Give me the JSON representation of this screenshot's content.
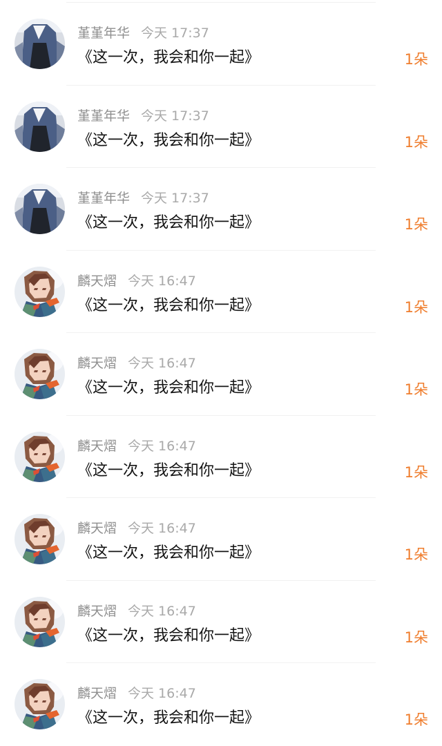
{
  "comments": [
    {
      "avatar": "user-avatar-denim",
      "name": "堇堇年华",
      "time": "今天 17:37",
      "message": "《这一次，我会和你一起》",
      "gift": "1朵"
    },
    {
      "avatar": "user-avatar-denim",
      "name": "堇堇年华",
      "time": "今天 17:37",
      "message": "《这一次，我会和你一起》",
      "gift": "1朵"
    },
    {
      "avatar": "user-avatar-denim",
      "name": "堇堇年华",
      "time": "今天 17:37",
      "message": "《这一次，我会和你一起》",
      "gift": "1朵"
    },
    {
      "avatar": "user-avatar-anime",
      "name": "麟天熠",
      "time": "今天 16:47",
      "message": "《这一次，我会和你一起》",
      "gift": "1朵"
    },
    {
      "avatar": "user-avatar-anime",
      "name": "麟天熠",
      "time": "今天 16:47",
      "message": "《这一次，我会和你一起》",
      "gift": "1朵"
    },
    {
      "avatar": "user-avatar-anime",
      "name": "麟天熠",
      "time": "今天 16:47",
      "message": "《这一次，我会和你一起》",
      "gift": "1朵"
    },
    {
      "avatar": "user-avatar-anime",
      "name": "麟天熠",
      "time": "今天 16:47",
      "message": "《这一次，我会和你一起》",
      "gift": "1朵"
    },
    {
      "avatar": "user-avatar-anime",
      "name": "麟天熠",
      "time": "今天 16:47",
      "message": "《这一次，我会和你一起》",
      "gift": "1朵"
    },
    {
      "avatar": "user-avatar-anime",
      "name": "麟天熠",
      "time": "今天 16:47",
      "message": "《这一次，我会和你一起》",
      "gift": "1朵"
    }
  ],
  "colors": {
    "gift": "#ef7d2d",
    "meta": "#999999",
    "message": "#141414"
  }
}
